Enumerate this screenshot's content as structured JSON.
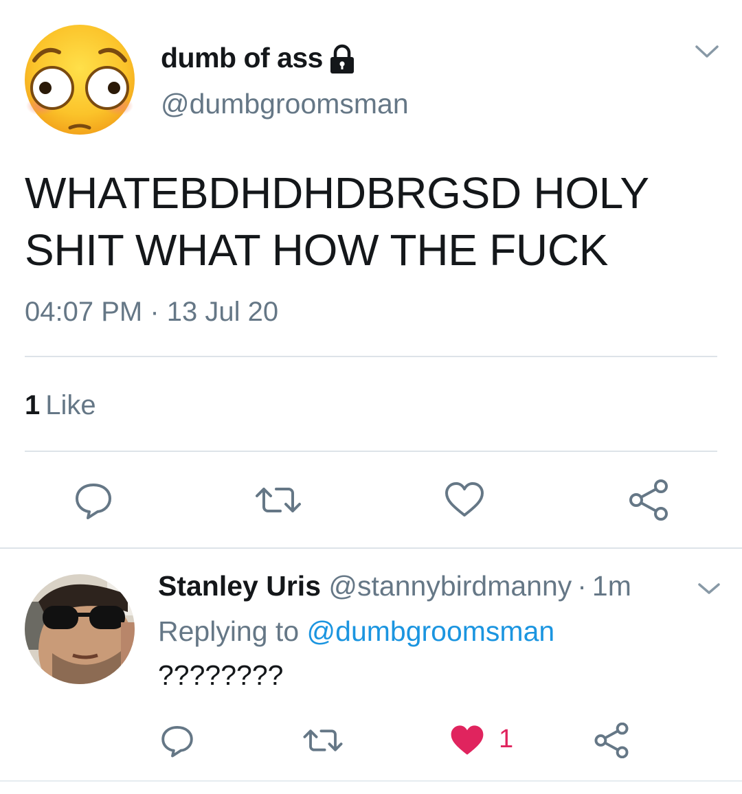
{
  "tweet": {
    "author_name": "dumb of ass",
    "author_handle": "@dumbgroomsman",
    "protected_icon": "lock-icon",
    "text": "WHATEBDHDHDBRGSD HOLY SHIT WHAT HOW THE FUCK",
    "timestamp": "04:07 PM · 13 Jul 20",
    "like_count": "1",
    "like_label": "Like",
    "actions": [
      "reply-icon",
      "retweet-icon",
      "heart-icon",
      "share-icon"
    ]
  },
  "reply": {
    "author_name": "Stanley Uris",
    "author_handle": "@stannybirdmanny",
    "separator": "·",
    "time": "1m",
    "replying_prefix": "Replying to",
    "replying_handle": "@dumbgroomsman",
    "text": "????????",
    "like_count": "1",
    "liked": true,
    "actions": [
      "reply-icon",
      "retweet-icon",
      "heart-icon",
      "share-icon"
    ]
  },
  "colors": {
    "text_primary": "#14171a",
    "text_secondary": "#657786",
    "link": "#1b95e0",
    "liked": "#e0245e",
    "divider": "#dde3e8",
    "icon": "#657786"
  }
}
